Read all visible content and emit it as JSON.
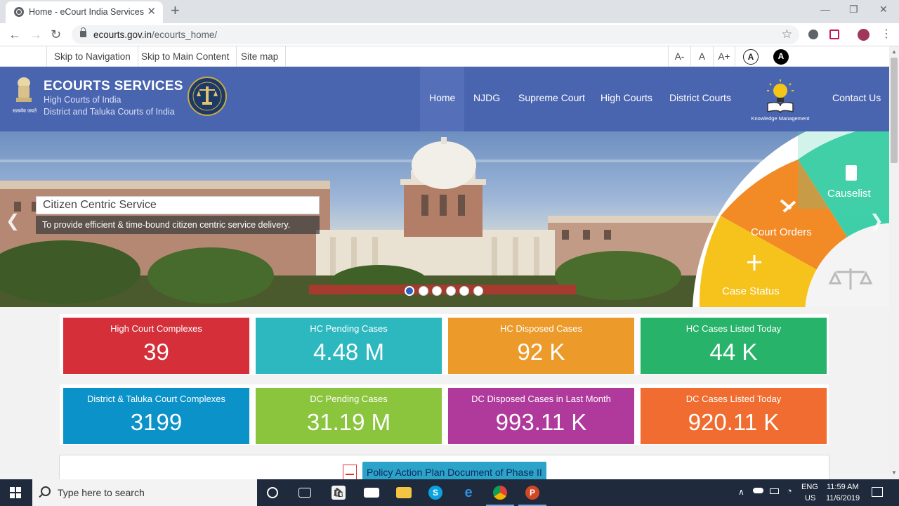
{
  "browser": {
    "tab_title": "Home - eCourt India Services",
    "url_host": "ecourts.gov.in",
    "url_path": "/ecourts_home/"
  },
  "utility_bar": {
    "skip_navigation": "Skip to Navigation",
    "skip_main": "Skip to Main Content",
    "site_map": "Site map",
    "font_decrease": "A-",
    "font_normal": "A",
    "font_increase": "A+",
    "contrast_normal": "A",
    "contrast_high": "A"
  },
  "header": {
    "title": "ECOURTS SERVICES",
    "subtitle_1": "High Courts of India",
    "subtitle_2": "District and Taluka Courts of India",
    "emblem_caption": "सत्यमेव जयते",
    "km_label": "Knowledge Management",
    "menu": [
      "Home",
      "NJDG",
      "Supreme Court",
      "High Courts",
      "District Courts",
      "Contact Us"
    ]
  },
  "hero": {
    "caption_title": "Citizen Centric Service",
    "caption_desc": "To provide efficient & time-bound citizen centric service delivery.",
    "wheel": [
      "Causelist",
      "Court Orders",
      "Case Status"
    ],
    "slide_count": 6,
    "active_slide": 1
  },
  "stats_row_1": [
    {
      "label": "High Court Complexes",
      "value": "39",
      "color": "#d5303a"
    },
    {
      "label": "HC Pending Cases",
      "value": "4.48 M",
      "color": "#2db8c0"
    },
    {
      "label": "HC Disposed Cases",
      "value": "92 K",
      "color": "#ec9a2a"
    },
    {
      "label": "HC Cases Listed Today",
      "value": "44 K",
      "color": "#27b36a"
    }
  ],
  "stats_row_2": [
    {
      "label": "District & Taluka Court Complexes",
      "value": "3199",
      "color": "#0b92c9"
    },
    {
      "label": "DC Pending Cases",
      "value": "31.19 M",
      "color": "#8bc53e"
    },
    {
      "label": "DC Disposed Cases in Last Month",
      "value": "993.11 K",
      "color": "#b0399c"
    },
    {
      "label": "DC Cases Listed Today",
      "value": "920.11 K",
      "color": "#f06c31"
    }
  ],
  "policy_button": "Policy Action Plan Document of Phase II",
  "taskbar": {
    "search_placeholder": "Type here to search",
    "lang_1": "ENG",
    "lang_2": "US",
    "time": "11:59 AM",
    "date": "11/6/2019"
  }
}
